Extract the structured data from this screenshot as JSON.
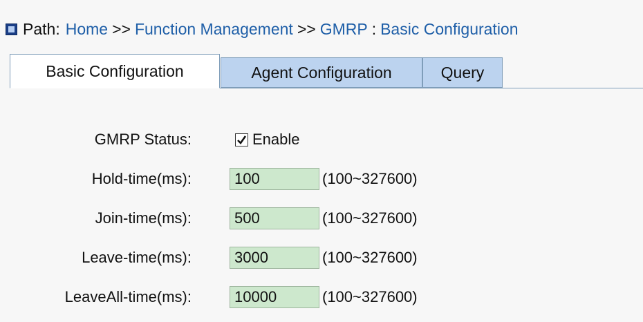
{
  "path": {
    "prefix": "Path:",
    "home": "Home",
    "sep1": ">>",
    "function_management": "Function Management",
    "sep2": ">>",
    "gmrp": "GMRP",
    "colon": ":",
    "basic_configuration": "Basic Configuration"
  },
  "tabs": [
    {
      "label": "Basic Configuration",
      "active": true
    },
    {
      "label": "Agent Configuration",
      "active": false
    },
    {
      "label": "Query",
      "active": false
    }
  ],
  "form": {
    "gmrp_status": {
      "label": "GMRP Status:",
      "checked": true,
      "option_label": "Enable"
    },
    "hold_time": {
      "label": "Hold-time(ms):",
      "value": "100",
      "range": "(100~327600)"
    },
    "join_time": {
      "label": "Join-time(ms):",
      "value": "500",
      "range": "(100~327600)"
    },
    "leave_time": {
      "label": "Leave-time(ms):",
      "value": "3000",
      "range": "(100~327600)"
    },
    "leaveall_time": {
      "label": "LeaveAll-time(ms):",
      "value": "10000",
      "range": "(100~327600)"
    }
  },
  "colors": {
    "link": "#1f5fa8",
    "tab_inactive": "#bcd3ef",
    "field_bg": "#cde8cd",
    "path_icon": "#1a3e86"
  }
}
